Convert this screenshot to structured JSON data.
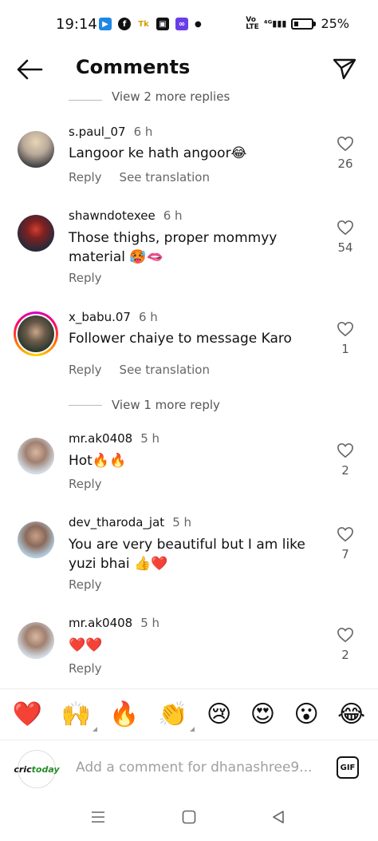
{
  "status": {
    "time": "19:14",
    "battery": "25%",
    "network": "4G"
  },
  "header": {
    "title": "Comments"
  },
  "view_replies_top": "View 2 more replies",
  "comments": [
    {
      "username": "s.paul_07",
      "time": "6 h",
      "text": "Langoor ke hath angoor😂",
      "actions": [
        "Reply",
        "See translation"
      ],
      "likes": "26"
    },
    {
      "username": "shawndotexee",
      "time": "6 h",
      "text": "Those thighs, proper mommyy material 🥵🫦",
      "actions": [
        "Reply"
      ],
      "likes": "54"
    },
    {
      "username": "x_babu.07",
      "time": "6 h",
      "text": "Follower chaiye to message Karo",
      "actions": [
        "Reply",
        "See translation"
      ],
      "likes": "1"
    },
    {
      "username": "mr.ak0408",
      "time": "5 h",
      "text": "Hot🔥🔥",
      "actions": [
        "Reply"
      ],
      "likes": "2"
    },
    {
      "username": "dev_tharoda_jat",
      "time": "5 h",
      "text": "You are very beautiful but I am like yuzi bhai 👍❤️",
      "actions": [
        "Reply"
      ],
      "likes": "7"
    },
    {
      "username": "mr.ak0408",
      "time": "5 h",
      "text": "❤️❤️",
      "actions": [
        "Reply"
      ],
      "likes": "2"
    }
  ],
  "view_more_reply": "View 1 more reply",
  "emoji_bar": [
    "❤️",
    "🙌",
    "🔥",
    "👏",
    "😢",
    "😍",
    "😮",
    "😂"
  ],
  "input": {
    "placeholder": "Add a comment for dhanashree9...",
    "avatar_text_a": "cric",
    "avatar_text_b": "today",
    "gif_label": "GIF"
  }
}
